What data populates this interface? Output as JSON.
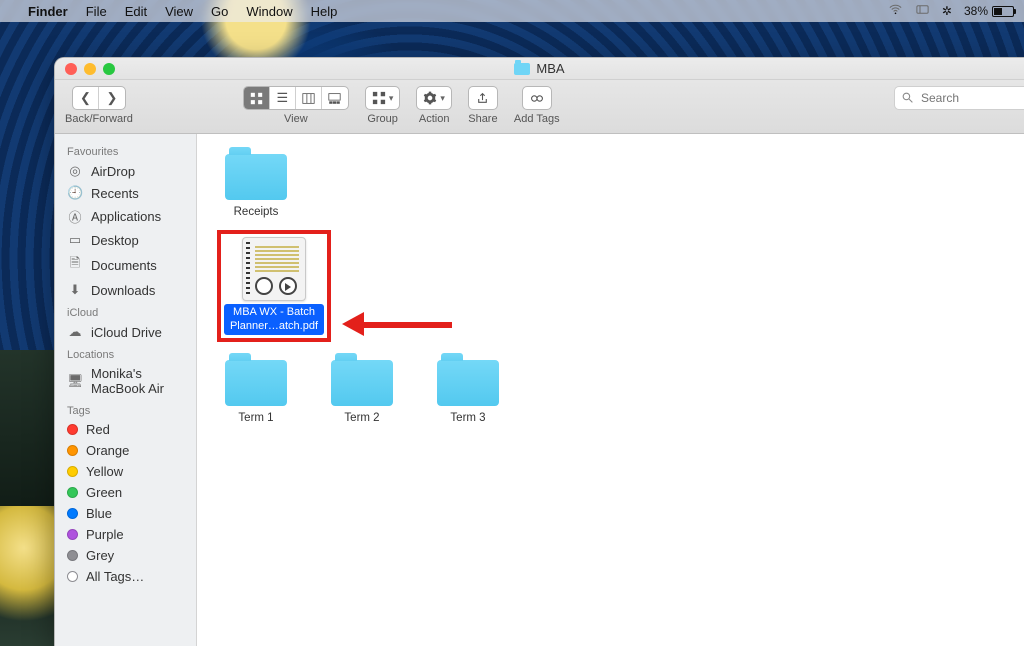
{
  "menubar": {
    "app": "Finder",
    "items": [
      "File",
      "Edit",
      "View",
      "Go",
      "Window",
      "Help"
    ],
    "battery_pct": "38%"
  },
  "window": {
    "title": "MBA"
  },
  "toolbar": {
    "back_forward_label": "Back/Forward",
    "view_label": "View",
    "group_label": "Group",
    "action_label": "Action",
    "share_label": "Share",
    "addtags_label": "Add Tags",
    "search_placeholder": "Search"
  },
  "sidebar": {
    "favourites_head": "Favourites",
    "favourites": [
      "AirDrop",
      "Recents",
      "Applications",
      "Desktop",
      "Documents",
      "Downloads"
    ],
    "icloud_head": "iCloud",
    "icloud": [
      "iCloud Drive"
    ],
    "locations_head": "Locations",
    "locations": [
      "Monika's MacBook Air"
    ],
    "tags_head": "Tags",
    "tags": [
      {
        "label": "Red",
        "color": "#ff3b30"
      },
      {
        "label": "Orange",
        "color": "#ff9500"
      },
      {
        "label": "Yellow",
        "color": "#ffcc00"
      },
      {
        "label": "Green",
        "color": "#34c759"
      },
      {
        "label": "Blue",
        "color": "#007aff"
      },
      {
        "label": "Purple",
        "color": "#af52de"
      },
      {
        "label": "Grey",
        "color": "#8e8e93"
      }
    ],
    "all_tags": "All Tags…"
  },
  "content": {
    "row1": [
      {
        "label": "Receipts"
      }
    ],
    "selected_file_label": "MBA WX - Batch Planner…atch.pdf",
    "row3": [
      {
        "label": "Term 1"
      },
      {
        "label": "Term 2"
      },
      {
        "label": "Term 3"
      }
    ]
  }
}
